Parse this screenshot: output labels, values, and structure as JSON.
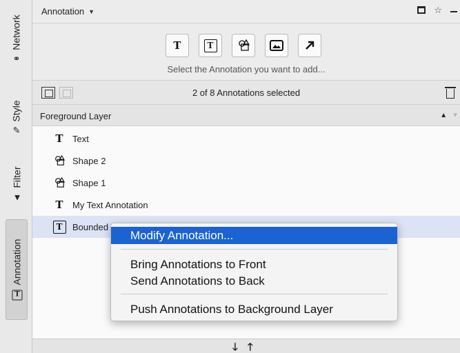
{
  "side_tabs": [
    {
      "label": "Network",
      "icon": "network-icon"
    },
    {
      "label": "Style",
      "icon": "brush-icon"
    },
    {
      "label": "Filter",
      "icon": "filter-icon"
    },
    {
      "label": "Annotation",
      "icon": "bounded-text-icon"
    }
  ],
  "panel": {
    "title": "Annotation",
    "add_hint": "Select the Annotation you want to add...",
    "add_buttons": [
      {
        "glyph": "T",
        "icon": "text-annotation-icon"
      },
      {
        "glyph": "T",
        "icon": "bounded-text-annotation-icon"
      },
      {
        "glyph": "⛫",
        "icon": "shape-annotation-icon"
      },
      {
        "glyph": "▣",
        "icon": "image-annotation-icon"
      },
      {
        "glyph": "↗",
        "icon": "arrow-annotation-icon"
      }
    ],
    "selection_status": "2 of 8 Annotations selected",
    "layer_title": "Foreground Layer"
  },
  "annotations": [
    {
      "label": "Text",
      "icon": "text-icon",
      "glyph": "T"
    },
    {
      "label": "Shape 2",
      "icon": "shape-icon",
      "glyph": "⛫"
    },
    {
      "label": "Shape 1",
      "icon": "shape-icon",
      "glyph": "⛫"
    },
    {
      "label": "My Text Annotation",
      "icon": "text-icon",
      "glyph": "T"
    },
    {
      "label": "Bounded Text Annotation",
      "icon": "bounded-text-icon",
      "glyph": "T",
      "selected": true
    }
  ],
  "context_menu": {
    "modify": "Modify Annotation...",
    "bring_front": "Bring Annotations to Front",
    "send_back": "Send Annotations to Back",
    "push_background": "Push Annotations to Background Layer"
  },
  "reorder": {
    "down": "🡓",
    "up": "🡑"
  },
  "colors": {
    "highlight": "#1b63d3",
    "selected_row": "#dbe3f4"
  }
}
